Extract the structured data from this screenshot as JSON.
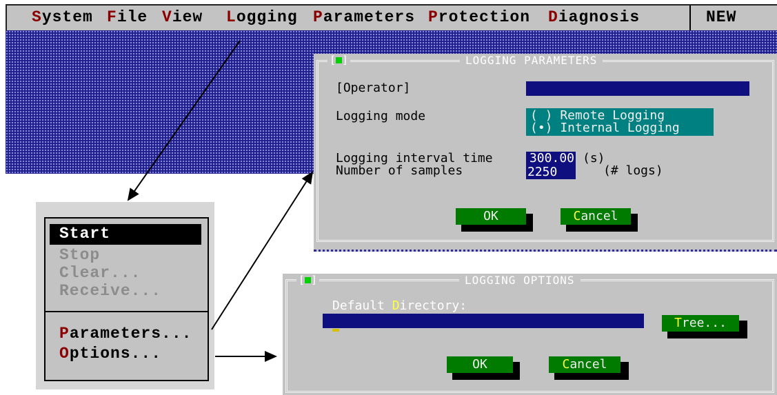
{
  "menubar": {
    "items": [
      {
        "hot": "S",
        "rest": "ystem"
      },
      {
        "hot": "F",
        "rest": "ile"
      },
      {
        "hot": "V",
        "rest": "iew"
      },
      {
        "hot": "L",
        "rest": "ogging"
      },
      {
        "hot": "P",
        "rest": "arameters"
      },
      {
        "hot": "P",
        "rest": "rotection"
      },
      {
        "hot": "D",
        "rest": "iagnosis"
      }
    ],
    "status": "NEW"
  },
  "logging_menu": {
    "start": "Start",
    "stop": "Stop",
    "clear": "Clear...",
    "receive": "Receive...",
    "parameters": {
      "hot": "P",
      "rest": "arameters..."
    },
    "options": {
      "hot": "O",
      "rest": "ptions..."
    }
  },
  "logging_parameters": {
    "title": "LOGGING PARAMETERS",
    "operator_label": "[Operator]",
    "operator_value": "",
    "mode_label": "Logging mode",
    "mode_remote": "( ) Remote Logging",
    "mode_internal": "(•) Internal Logging",
    "interval_label": "Logging interval time",
    "interval_value": "300.00",
    "interval_unit": "(s)",
    "samples_label": "Number of samples",
    "samples_value": "2250",
    "samples_unit": "(# logs)",
    "ok": "OK",
    "cancel_hot": "C",
    "cancel_rest": "ancel"
  },
  "logging_options": {
    "title": "LOGGING OPTIONS",
    "dir_label_pre": "Default ",
    "dir_label_hot": "D",
    "dir_label_post": "irectory:",
    "dir_value": "",
    "tree_hot": "T",
    "tree_rest": "ree...",
    "ok": "OK",
    "cancel_hot": "C",
    "cancel_rest": "ancel"
  },
  "colors": {
    "menubar_bg": "#c3c3c3",
    "hotkey": "#8a0000",
    "desktop": "#1c1c8c",
    "field": "#0f0f7f",
    "teal": "#008080",
    "button": "#007b00",
    "button_hotkey": "#ffff40",
    "close_green": "#00d000"
  }
}
